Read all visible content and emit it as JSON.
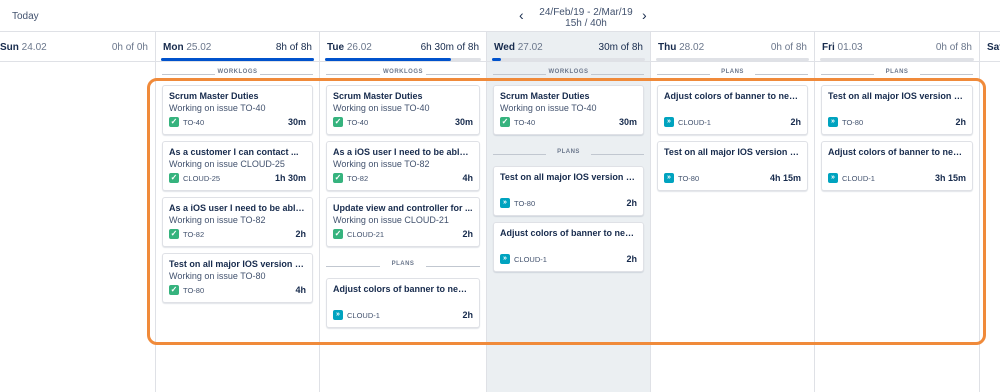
{
  "header": {
    "today_label": "Today",
    "prev_icon": "chevron-left-icon",
    "next_icon": "chevron-right-icon",
    "range": "24/Feb/19 - 2/Mar/19",
    "hours": "15h / 40h"
  },
  "colors": {
    "accent": "#0052cc",
    "done": "#36b37e",
    "plan": "#00a3bf",
    "highlight": "#f08a3a",
    "today_bg": "#ebeff2"
  },
  "days": [
    {
      "name": "Sun",
      "date": "24.02",
      "hours": "0h of 0h",
      "progress": 0
    },
    {
      "name": "Mon",
      "date": "25.02",
      "hours": "8h of 8h",
      "progress": 1.0,
      "section": "WORKLOGS",
      "cards": [
        {
          "title": "Scrum Master Duties",
          "sub": "Working on issue TO-40",
          "key": "TO-40",
          "time": "30m",
          "icon": "check-icon"
        },
        {
          "title": "As a customer I can contact ...",
          "sub": "Working on issue CLOUD-25",
          "key": "CLOUD-25",
          "time": "1h 30m",
          "icon": "check-icon"
        },
        {
          "title": "As a iOS user I need to be able ...",
          "sub": "Working on issue TO-82",
          "key": "TO-82",
          "time": "2h",
          "icon": "check-icon"
        },
        {
          "title": "Test on all major IOS version a...",
          "sub": "Working on issue TO-80",
          "key": "TO-80",
          "time": "4h",
          "icon": "check-icon"
        }
      ]
    },
    {
      "name": "Tue",
      "date": "26.02",
      "hours": "6h 30m of 8h",
      "progress": 0.81,
      "section": "WORKLOGS",
      "cards": [
        {
          "title": "Scrum Master Duties",
          "sub": "Working on issue TO-40",
          "key": "TO-40",
          "time": "30m",
          "icon": "check-icon"
        },
        {
          "title": "As a iOS user I need to be able ...",
          "sub": "Working on issue TO-82",
          "key": "TO-82",
          "time": "4h",
          "icon": "check-icon"
        },
        {
          "title": "Update view and controller for ...",
          "sub": "Working on issue CLOUD-21",
          "key": "CLOUD-21",
          "time": "2h",
          "icon": "check-icon"
        }
      ],
      "plans_label": "PLANS",
      "plans": [
        {
          "title": "Adjust colors of banner to new ...",
          "key": "CLOUD-1",
          "time": "2h",
          "icon": "plan-icon"
        }
      ]
    },
    {
      "name": "Wed",
      "date": "27.02",
      "hours": "30m of 8h",
      "progress": 0.06,
      "section": "WORKLOGS",
      "cards": [
        {
          "title": "Scrum Master Duties",
          "sub": "Working on issue TO-40",
          "key": "TO-40",
          "time": "30m",
          "icon": "check-icon"
        }
      ],
      "plans_label": "PLANS",
      "plans": [
        {
          "title": "Test on all major IOS version a...",
          "key": "TO-80",
          "time": "2h",
          "icon": "plan-icon"
        },
        {
          "title": "Adjust colors of banner to new ...",
          "key": "CLOUD-1",
          "time": "2h",
          "icon": "plan-icon"
        }
      ]
    },
    {
      "name": "Thu",
      "date": "28.02",
      "hours": "0h of 8h",
      "progress": 0,
      "section": "PLANS",
      "plans": [
        {
          "title": "Adjust colors of banner to new ...",
          "key": "CLOUD-1",
          "time": "2h",
          "icon": "plan-icon"
        },
        {
          "title": "Test on all major IOS version a...",
          "key": "TO-80",
          "time": "4h 15m",
          "icon": "plan-icon"
        }
      ]
    },
    {
      "name": "Fri",
      "date": "01.03",
      "hours": "0h of 8h",
      "progress": 0,
      "section": "PLANS",
      "plans": [
        {
          "title": "Test on all major IOS version a...",
          "key": "TO-80",
          "time": "2h",
          "icon": "plan-icon"
        },
        {
          "title": "Adjust colors of banner to new ...",
          "key": "CLOUD-1",
          "time": "3h 15m",
          "icon": "plan-icon"
        }
      ]
    },
    {
      "name": "Sat",
      "date": "",
      "hours": "",
      "progress": 0
    }
  ]
}
